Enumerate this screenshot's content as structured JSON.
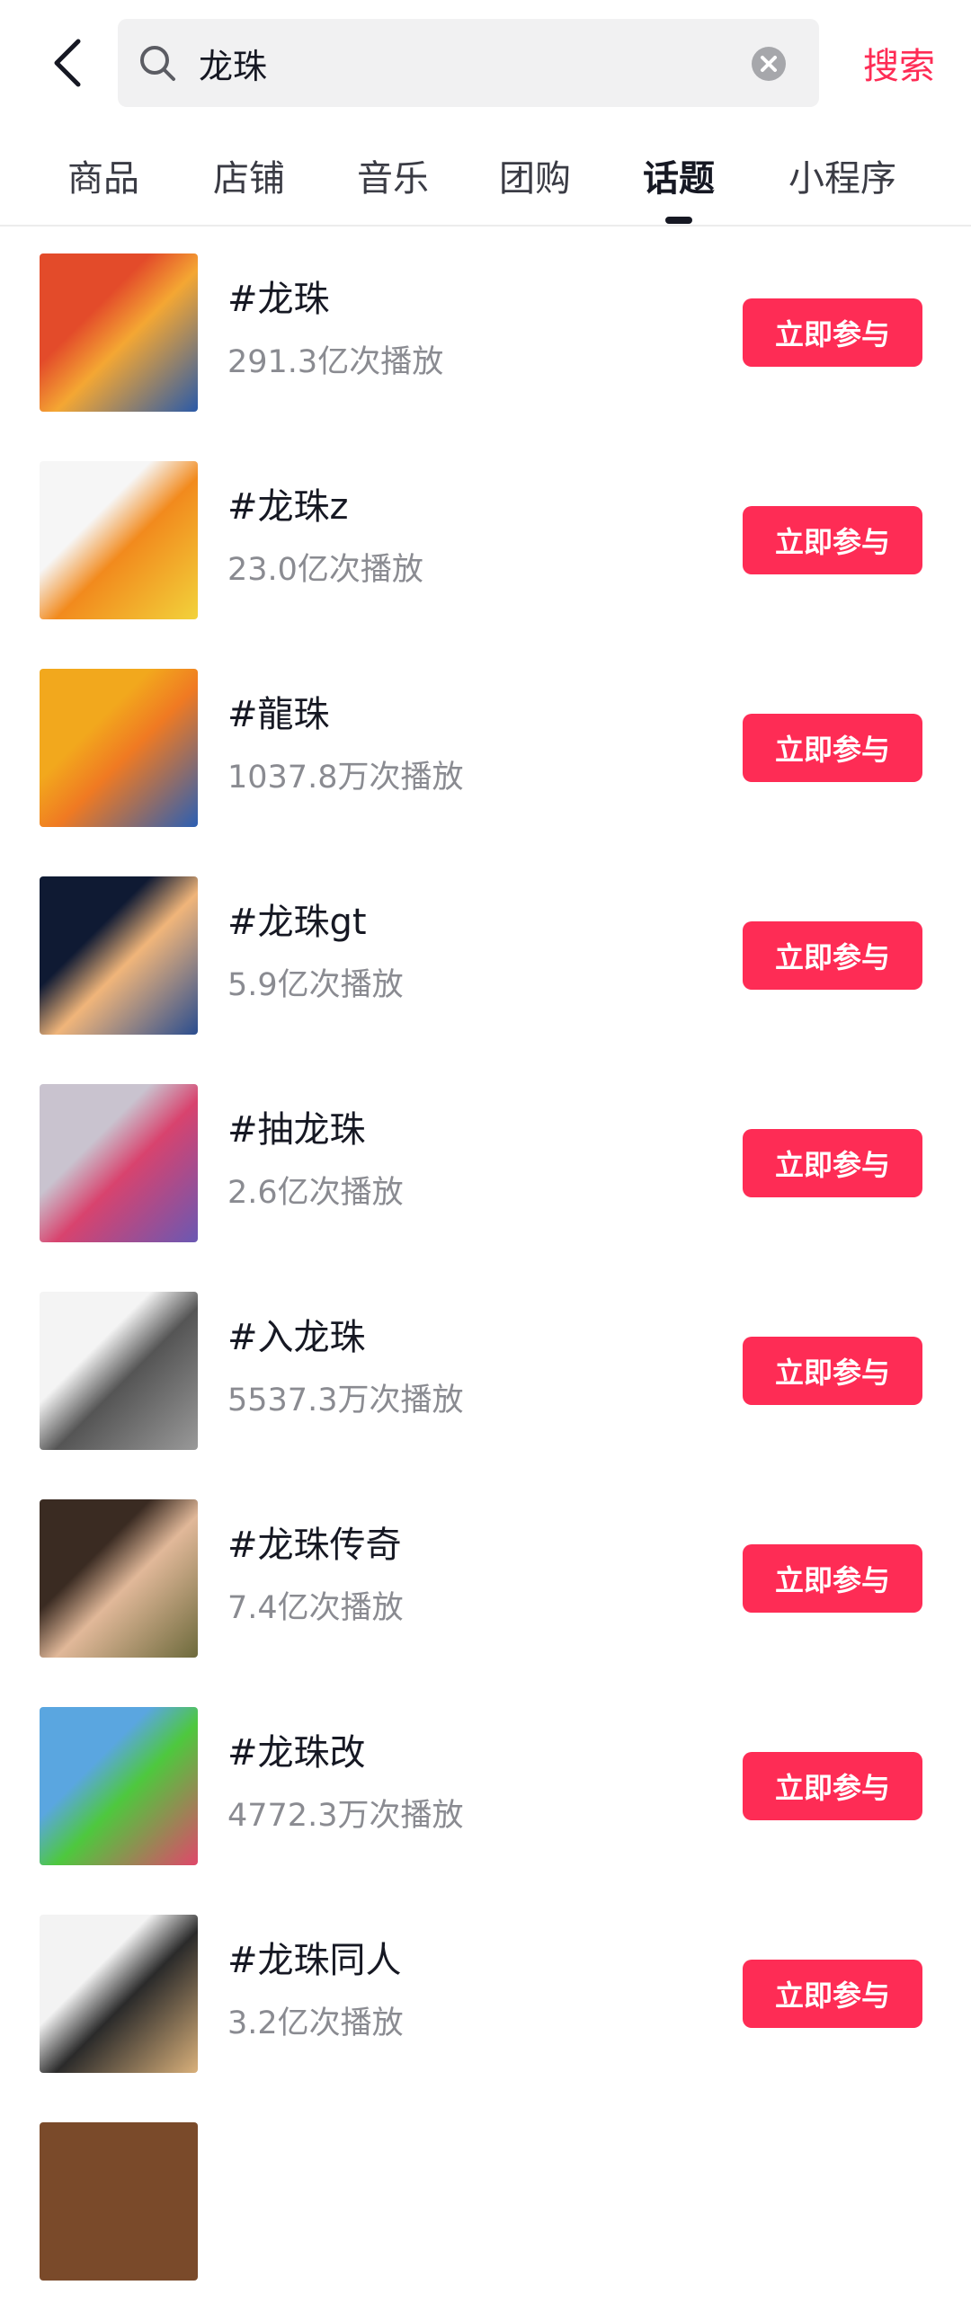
{
  "search": {
    "query": "龙珠",
    "submit_label": "搜索"
  },
  "tabs": [
    {
      "label": "商品"
    },
    {
      "label": "店铺"
    },
    {
      "label": "音乐"
    },
    {
      "label": "团购"
    },
    {
      "label": "话题",
      "active": true
    },
    {
      "label": "小程序"
    }
  ],
  "topics": [
    {
      "title": "#龙珠",
      "plays": "291.3亿次播放",
      "action": "立即参与",
      "thumb_colors": [
        "#e34b2a",
        "#f4a733",
        "#2a5aa8"
      ]
    },
    {
      "title": "#龙珠z",
      "plays": "23.0亿次播放",
      "action": "立即参与",
      "thumb_colors": [
        "#f6f6f6",
        "#f28a1d",
        "#f2d23b"
      ]
    },
    {
      "title": "#龍珠",
      "plays": "1037.8万次播放",
      "action": "立即参与",
      "thumb_colors": [
        "#f2a81d",
        "#f07a22",
        "#2b5fb3"
      ]
    },
    {
      "title": "#龙珠gt",
      "plays": "5.9亿次播放",
      "action": "立即参与",
      "thumb_colors": [
        "#0f1a33",
        "#f0b57a",
        "#2a4d8f"
      ]
    },
    {
      "title": "#抽龙珠",
      "plays": "2.6亿次播放",
      "action": "立即参与",
      "thumb_colors": [
        "#c9c3cf",
        "#d8436e",
        "#6a58b3"
      ]
    },
    {
      "title": "#入龙珠",
      "plays": "5537.3万次播放",
      "action": "立即参与",
      "thumb_colors": [
        "#f4f4f4",
        "#555555",
        "#999999"
      ]
    },
    {
      "title": "#龙珠传奇",
      "plays": "7.4亿次播放",
      "action": "立即参与",
      "thumb_colors": [
        "#3a2b22",
        "#e1b899",
        "#6d6a3c"
      ]
    },
    {
      "title": "#龙珠改",
      "plays": "4772.3万次播放",
      "action": "立即参与",
      "thumb_colors": [
        "#5aa6e0",
        "#4ec83e",
        "#e0476a"
      ]
    },
    {
      "title": "#龙珠同人",
      "plays": "3.2亿次播放",
      "action": "立即参与",
      "thumb_colors": [
        "#f3f3f3",
        "#2a2a2a",
        "#d9b07a"
      ]
    }
  ],
  "colors": {
    "accent": "#fe2c55",
    "muted_text": "#8a8b91"
  }
}
